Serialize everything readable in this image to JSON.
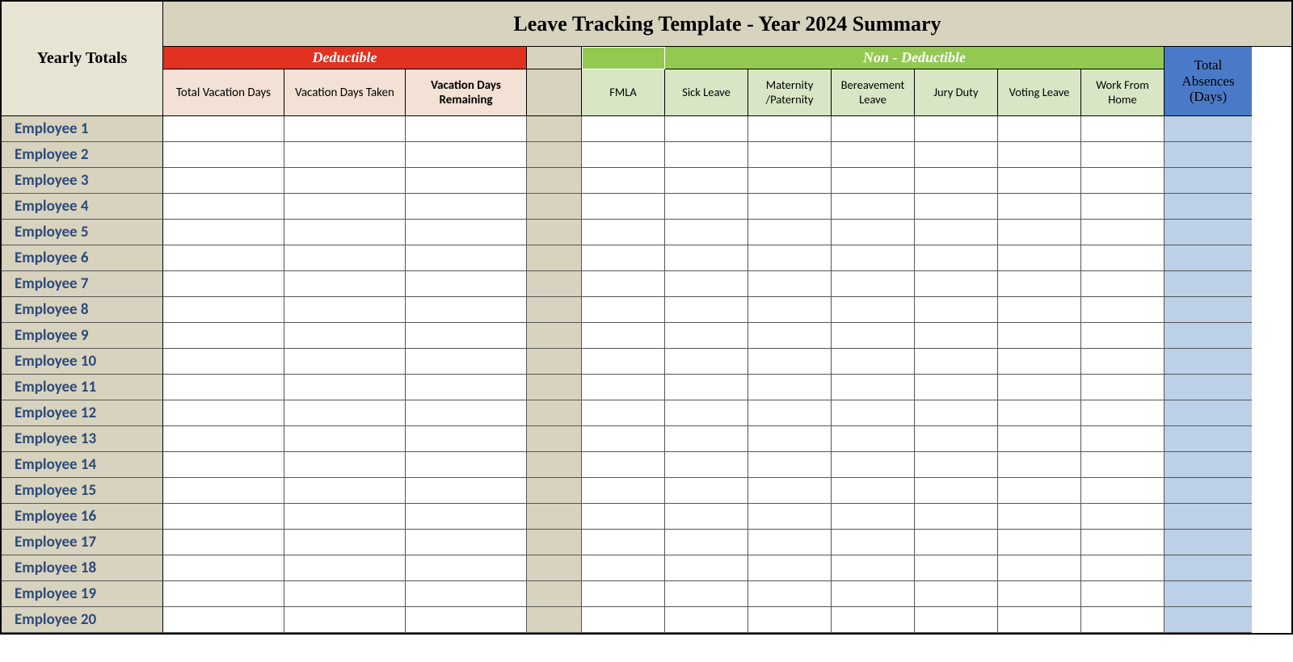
{
  "header": {
    "corner_label": "Yearly Totals",
    "title": "Leave Tracking Template - Year 2024 Summary",
    "deductible_label": "Deductible",
    "non_deductible_label": "Non - Deductible",
    "total_absences_label": "Total Absences (Days)"
  },
  "deductible_columns": [
    "Total Vacation Days",
    "Vacation Days Taken",
    "Vacation Days Remaining"
  ],
  "non_deductible_columns": [
    "FMLA",
    "Sick Leave",
    "Maternity /Paternity",
    "Bereavement Leave",
    "Jury Duty",
    "Voting Leave",
    "Work From Home"
  ],
  "employees": [
    "Employee 1",
    "Employee 2",
    "Employee 3",
    "Employee 4",
    "Employee 5",
    "Employee 6",
    "Employee 7",
    "Employee 8",
    "Employee 9",
    "Employee 10",
    "Employee 11",
    "Employee 12",
    "Employee 13",
    "Employee 14",
    "Employee 15",
    "Employee 16",
    "Employee 17",
    "Employee 18",
    "Employee 19",
    "Employee 20"
  ]
}
